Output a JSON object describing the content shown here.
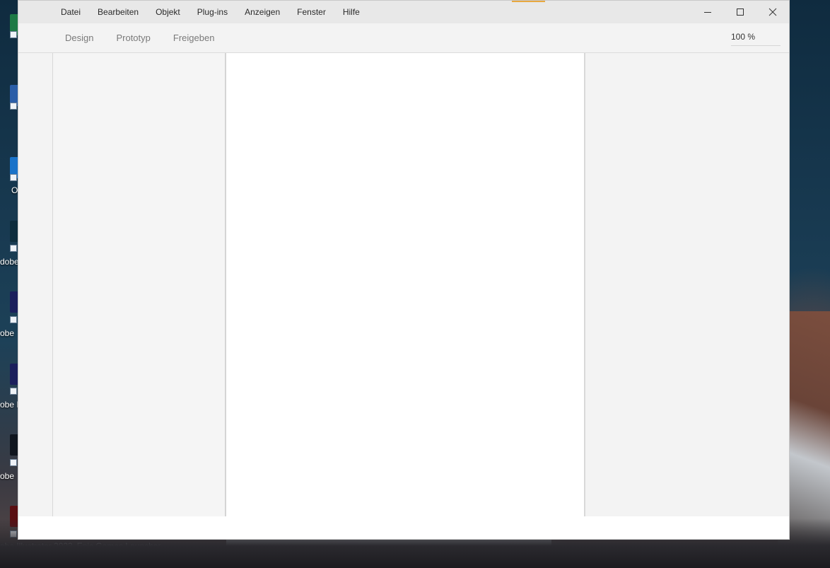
{
  "menu": {
    "items": [
      "Datei",
      "Bearbeiten",
      "Objekt",
      "Plug-ins",
      "Anzeigen",
      "Fenster",
      "Hilfe"
    ]
  },
  "window_controls": {
    "minimize": "minimize-icon",
    "maximize": "maximize-icon",
    "close": "close-icon"
  },
  "toolbar": {
    "tabs": [
      "Design",
      "Prototyp",
      "Freigeben"
    ],
    "zoom": "100 %"
  },
  "desktop": {
    "icon_labels": [
      "O",
      "dobe",
      "obe",
      "obe I",
      "obe"
    ],
    "taskbar_labels": [
      "obe Illustrator 2023",
      "Epic Games Launcher"
    ]
  },
  "colors": {
    "accent": "#e8a840",
    "titlebar": "#e8e8e8",
    "panel": "#f3f3f3"
  }
}
